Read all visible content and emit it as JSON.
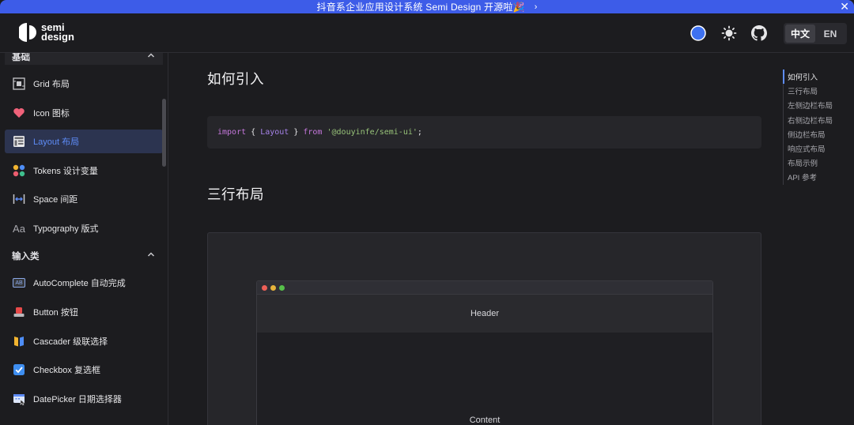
{
  "banner": {
    "text": "抖音系企业应用设计系统 Semi Design 开源啦🎉",
    "chevron": "›",
    "close": "✕"
  },
  "header": {
    "logo_text_1": "semi",
    "logo_text_2": "design",
    "icons": [
      "theme-color-icon",
      "sun-icon",
      "github-icon"
    ],
    "lang": [
      "中文",
      "EN"
    ],
    "lang_active": "中文"
  },
  "sidebar": {
    "groups": [
      {
        "label": "基础",
        "items": [
          {
            "label": "Grid 布局",
            "icon": "grid-icon"
          },
          {
            "label": "Icon 图标",
            "icon": "heart-icon"
          },
          {
            "label": "Layout 布局",
            "icon": "layout-icon",
            "active": true
          },
          {
            "label": "Tokens 设计变量",
            "icon": "tokens-icon"
          },
          {
            "label": "Space 间距",
            "icon": "space-icon"
          },
          {
            "label": "Typography 版式",
            "icon": "typography-icon",
            "glyph": "Aa"
          }
        ]
      },
      {
        "label": "输入类",
        "items": [
          {
            "label": "AutoComplete 自动完成",
            "icon": "autocomplete-icon",
            "glyph": "AB"
          },
          {
            "label": "Button 按钮",
            "icon": "button-icon"
          },
          {
            "label": "Cascader 级联选择",
            "icon": "cascader-icon"
          },
          {
            "label": "Checkbox 复选框",
            "icon": "checkbox-icon"
          },
          {
            "label": "DatePicker 日期选择器",
            "icon": "datepicker-icon"
          }
        ]
      }
    ]
  },
  "main": {
    "section1_title": "如何引入",
    "code": {
      "kw_import": "import",
      "brace_open": " { ",
      "ident": "Layout",
      "brace_close": " } ",
      "kw_from": "from",
      "space": " ",
      "string": "'@douyinfe/semi-ui'",
      "semi": ";"
    },
    "section2_title": "三行布局",
    "demo": {
      "header_label": "Header",
      "content_label": "Content",
      "dot_colors": [
        "#ed5f57",
        "#e6b33b",
        "#56c04a"
      ]
    }
  },
  "toc": {
    "items": [
      "如何引入",
      "三行布局",
      "左侧边栏布局",
      "右侧边栏布局",
      "侧边栏布局",
      "响应式布局",
      "布局示例",
      "API 参考"
    ],
    "active": "如何引入"
  },
  "colors": {
    "accent": "#3d5ce8",
    "active_text": "#5e8cf7",
    "background": "#1c1c1f"
  }
}
